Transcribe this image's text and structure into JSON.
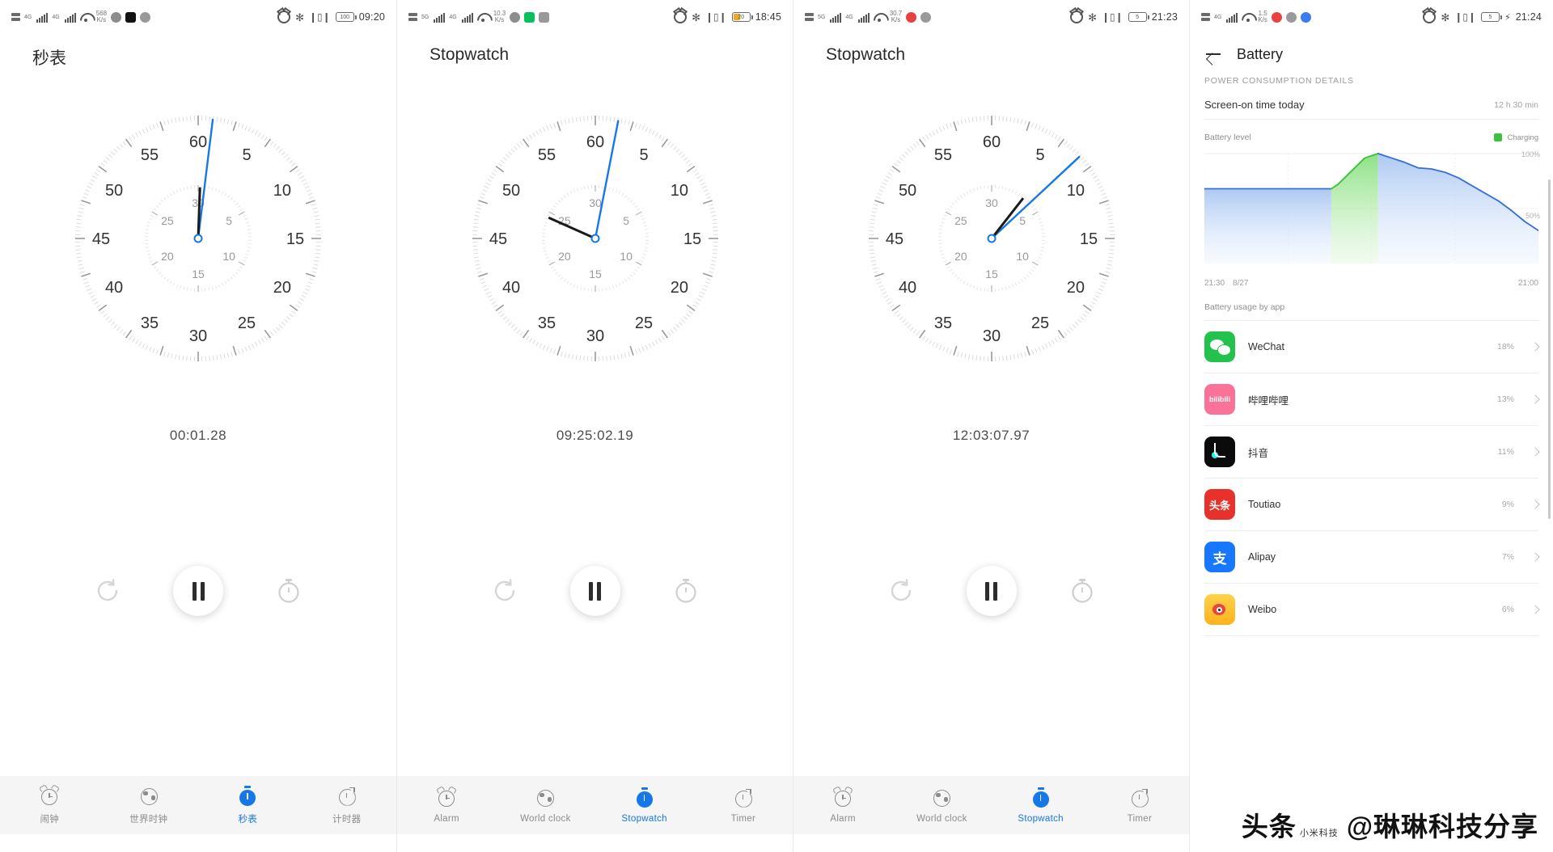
{
  "panels": [
    {
      "status": {
        "net_speed": "568",
        "net_unit": "K/s",
        "g1": "4G",
        "g2": "4G",
        "battery": "100",
        "battery_state": "normal",
        "time": "09:20"
      },
      "title": "秒表",
      "time_display": "00:01.28",
      "nav": [
        {
          "label": "闹钟",
          "icon": "alarm-icon",
          "active": false
        },
        {
          "label": "世界时钟",
          "icon": "globe-icon",
          "active": false
        },
        {
          "label": "秒表",
          "icon": "stopwatch-icon",
          "active": true
        },
        {
          "label": "计时器",
          "icon": "timer-icon",
          "active": false
        }
      ]
    },
    {
      "status": {
        "net_speed": "10.3",
        "net_unit": "K/s",
        "g1": "5G",
        "g2": "4G",
        "battery": "20",
        "battery_state": "low",
        "time": "18:45"
      },
      "title": "Stopwatch",
      "time_display": "09:25:02.19",
      "nav": [
        {
          "label": "Alarm",
          "icon": "alarm-icon",
          "active": false
        },
        {
          "label": "World clock",
          "icon": "globe-icon",
          "active": false
        },
        {
          "label": "Stopwatch",
          "icon": "stopwatch-icon",
          "active": true
        },
        {
          "label": "Timer",
          "icon": "timer-icon",
          "active": false
        }
      ]
    },
    {
      "status": {
        "net_speed": "30.7",
        "net_unit": "K/s",
        "g1": "5G",
        "g2": "4G",
        "battery": "5",
        "battery_state": "critical",
        "time": "21:23"
      },
      "title": "Stopwatch",
      "time_display": "12:03:07.97",
      "nav": [
        {
          "label": "Alarm",
          "icon": "alarm-icon",
          "active": false
        },
        {
          "label": "World clock",
          "icon": "globe-icon",
          "active": false
        },
        {
          "label": "Stopwatch",
          "icon": "stopwatch-icon",
          "active": true
        },
        {
          "label": "Timer",
          "icon": "timer-icon",
          "active": false
        }
      ]
    }
  ],
  "dial": {
    "outer_labels": [
      "60",
      "5",
      "10",
      "15",
      "20",
      "25",
      "30",
      "35",
      "40",
      "45",
      "50",
      "55"
    ],
    "inner_labels": [
      "30",
      "5",
      "10",
      "15",
      "20",
      "25"
    ]
  },
  "battery_page": {
    "status": {
      "net_speed": "1.5",
      "net_unit": "K/s",
      "g1": "4G",
      "battery": "5",
      "battery_state": "charging",
      "time": "21:24"
    },
    "title": "Battery",
    "section_label": "POWER CONSUMPTION DETAILS",
    "screen_on": {
      "label": "Screen-on time today",
      "value": "12 h 30 min"
    },
    "chart_label": "Battery level",
    "legend": "Charging",
    "legend_color": "#3ec13e",
    "y_top": "100%",
    "y_mid": "50%",
    "x_start": "21:30",
    "x_date": "8/27",
    "x_end": "21:00",
    "usage_header": "Battery usage by app",
    "apps": [
      {
        "name": "WeChat",
        "pct": "18%",
        "icon": "wechat-icon",
        "glyph": ""
      },
      {
        "name": "哔哩哔哩",
        "pct": "13%",
        "icon": "bilibili-icon",
        "glyph": "bilibili"
      },
      {
        "name": "抖音",
        "pct": "11%",
        "icon": "tiktok-icon",
        "glyph": ""
      },
      {
        "name": "Toutiao",
        "pct": "9%",
        "icon": "toutiao-icon",
        "glyph": "头条"
      },
      {
        "name": "Alipay",
        "pct": "7%",
        "icon": "alipay-icon",
        "glyph": "支"
      },
      {
        "name": "Weibo",
        "pct": "6%",
        "icon": "weibo-icon",
        "glyph": ""
      }
    ]
  },
  "chart_data": {
    "type": "area",
    "title": "Battery level",
    "xlabel": "",
    "ylabel": "Battery level (%)",
    "ylim": [
      0,
      100
    ],
    "yticks": [
      50,
      100
    ],
    "ytick_labels": [
      "50%",
      "100%"
    ],
    "xticks": [
      "21:30",
      "21:00"
    ],
    "x_date": "8/27",
    "grid": true,
    "legend": [
      {
        "name": "Charging",
        "color": "#3ec13e"
      }
    ],
    "legend_position": "top-right",
    "line_color": "#3a6fd8",
    "x": [
      0,
      8,
      14,
      20,
      26,
      32,
      38,
      40,
      44,
      48,
      52,
      56,
      60,
      64,
      68,
      72,
      76,
      80,
      84,
      88,
      92,
      96,
      100
    ],
    "values": [
      68,
      68,
      68,
      68,
      68,
      68,
      68,
      72,
      84,
      96,
      100,
      96,
      92,
      87,
      86,
      83,
      78,
      71,
      64,
      57,
      48,
      38,
      30
    ],
    "charging_span": [
      38,
      52
    ],
    "series": [
      {
        "name": "Battery level",
        "values": [
          68,
          68,
          68,
          68,
          68,
          68,
          68,
          72,
          84,
          96,
          100,
          96,
          92,
          87,
          86,
          83,
          78,
          71,
          64,
          57,
          48,
          38,
          30
        ]
      }
    ]
  },
  "watermark": {
    "logo": "头条",
    "sub": "小米科技",
    "handle": "@琳琳科技分享"
  }
}
